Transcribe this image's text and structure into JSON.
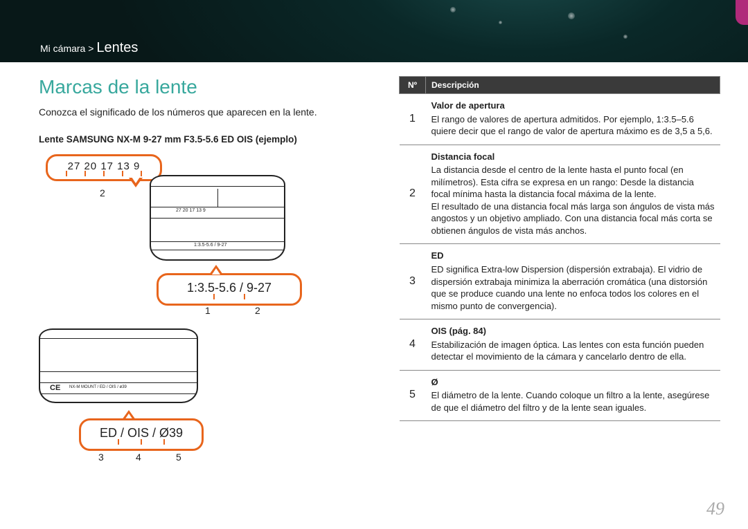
{
  "breadcrumb": {
    "parent": "Mi cámara",
    "sep": ">",
    "section": "Lentes"
  },
  "title": "Marcas de la lente",
  "intro": "Conozca el significado de los números que aparecen en la lente.",
  "example_label": "Lente SAMSUNG NX-M 9-27 mm F3.5-5.6 ED OIS (ejemplo)",
  "callouts": {
    "focal_ring": "27 20 17   13       9",
    "focal_marker": "2",
    "aperture_line": "1:3.5-5.6 / 9-27",
    "aperture_m1": "1",
    "aperture_m2": "2",
    "bottom_line": "ED / OIS / Ø39",
    "bottom_m3": "3",
    "bottom_m4": "4",
    "bottom_m5": "5"
  },
  "lens_labels": {
    "ring_nums": "27  20  17   13     9",
    "spec_line": "1:3.5-5.6 / 9-27",
    "mount_line": "NX-M MOUNT / ED / OIS / ø39",
    "ce": "CE"
  },
  "table": {
    "head_no": "Nº",
    "head_desc": "Descripción",
    "rows": [
      {
        "n": "1",
        "term": "Valor de apertura",
        "text": "El rango de valores de apertura admitidos. Por ejemplo, 1:3.5–5.6 quiere decir que el rango de valor de apertura máximo es de 3,5 a 5,6."
      },
      {
        "n": "2",
        "term": "Distancia focal",
        "text": "La distancia desde el centro de la lente hasta el punto focal (en milímetros). Esta cifra se expresa en un rango: Desde la distancia focal mínima hasta la distancia focal máxima de la lente.\nEl resultado de una distancia focal más larga son ángulos de vista más angostos y un objetivo ampliado. Con una distancia focal más corta se obtienen ángulos de vista más anchos."
      },
      {
        "n": "3",
        "term": "ED",
        "text": "ED significa Extra-low Dispersion (dispersión extrabaja). El vidrio de dispersión extrabaja minimiza la aberración cromática (una distorsión que se produce cuando una lente no enfoca todos los colores en el mismo punto de convergencia)."
      },
      {
        "n": "4",
        "term": "OIS (pág. 84)",
        "text": "Estabilización de imagen óptica. Las lentes con esta función pueden detectar el movimiento de la cámara y cancelarlo dentro de ella."
      },
      {
        "n": "5",
        "term": "Ø",
        "text": "El diámetro de la lente. Cuando coloque un filtro a la lente, asegúrese de que el diámetro del filtro y de la lente sean iguales."
      }
    ]
  },
  "page_number": "49"
}
